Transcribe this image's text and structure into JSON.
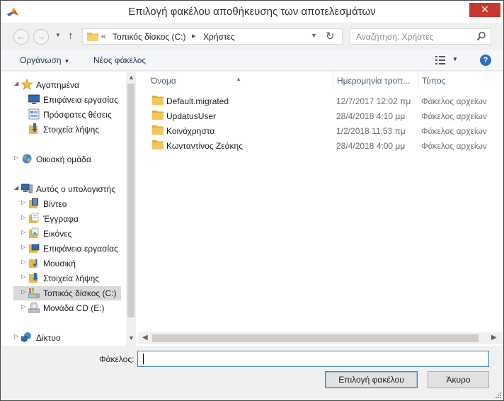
{
  "window": {
    "title": "Επιλογή φακέλου αποθήκευσης των αποτελεσμάτων",
    "close_label": "✕"
  },
  "address_bar": {
    "overflow": "«",
    "crumbs": [
      "Τοπικός δίσκος (C:)",
      "Χρήστες"
    ],
    "search_placeholder": "Αναζήτηση: Χρήστες"
  },
  "toolbar": {
    "organize_label": "Οργάνωση",
    "new_folder_label": "Νέος φάκελος"
  },
  "nav_pane": {
    "items": [
      {
        "label": "Αγαπημένα",
        "icon": "star-icon",
        "expanded": true
      },
      {
        "label": "Επιφάνεια εργασίας",
        "icon": "desktop-icon"
      },
      {
        "label": "Πρόσφατες θέσεις",
        "icon": "recent-places-icon"
      },
      {
        "label": "Στοιχεία λήψης",
        "icon": "downloads-icon"
      },
      {
        "label": "Οικιακή ομάδα",
        "icon": "homegroup-icon"
      },
      {
        "label": "Αυτός ο υπολογιστής",
        "icon": "computer-icon",
        "expanded": true
      },
      {
        "label": "Βίντεο",
        "icon": "videos-icon"
      },
      {
        "label": "Έγγραφα",
        "icon": "documents-icon"
      },
      {
        "label": "Εικόνες",
        "icon": "pictures-icon"
      },
      {
        "label": "Επιφάνεια εργασίας",
        "icon": "desktop-folder-icon"
      },
      {
        "label": "Μουσική",
        "icon": "music-icon"
      },
      {
        "label": "Στοιχεία λήψης",
        "icon": "downloads-folder-icon"
      },
      {
        "label": "Τοπικός δίσκος (C:)",
        "icon": "local-disk-icon",
        "selected": true
      },
      {
        "label": "Μονάδα CD (E:)",
        "icon": "cd-drive-icon"
      },
      {
        "label": "Δίκτυο",
        "icon": "network-icon"
      }
    ]
  },
  "file_list": {
    "columns": [
      "Όνομα",
      "Ημερομηνία τροπ...",
      "Τύπος"
    ],
    "rows": [
      {
        "name": "Default.migrated",
        "date": "12/7/2017 12:02 πμ",
        "type": "Φάκελος αρχείων"
      },
      {
        "name": "UpdatusUser",
        "date": "28/4/2018 4:10 μμ",
        "type": "Φάκελος αρχείων"
      },
      {
        "name": "Κοινόχρηστα",
        "date": "1/2/2018 11:53 πμ",
        "type": "Φάκελος αρχείων"
      },
      {
        "name": "Κωνταντίνος Ζεάκης",
        "date": "28/4/2018 4:00 μμ",
        "type": "Φάκελος αρχείων"
      }
    ]
  },
  "footer": {
    "folder_label": "Φάκελος:",
    "folder_value": "",
    "select_button": "Επιλογή φακέλου",
    "cancel_button": "Άκυρο"
  },
  "colors": {
    "close_button": "#c7392f",
    "accent_border": "#3c7fb1",
    "folder_yellow": "#e8b94a"
  }
}
